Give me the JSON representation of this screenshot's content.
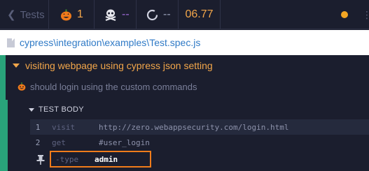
{
  "topbar": {
    "back_label": "Tests",
    "passed_count": "1",
    "failed_count": "--",
    "pending_count": "--",
    "duration": "06.77",
    "status_color": "#f4a623"
  },
  "spec": {
    "path": "cypress\\integration\\examples\\Test.spec.js"
  },
  "suite": {
    "title": "visiting webpage using cypress json setting",
    "test_title": "should login using the custom commands",
    "body_label": "TEST BODY",
    "commands": [
      {
        "num": "1",
        "name": "visit",
        "message": "http://zero.webappsecurity.com/login.html"
      },
      {
        "num": "2",
        "name": "get",
        "message": "#user_login"
      },
      {
        "num": "",
        "name": "-type",
        "message": "admin"
      }
    ]
  },
  "icons": {
    "passed": "pumpkin-icon",
    "failed": "skull-crossbones-icon",
    "pending": "circle-spinner-icon",
    "pin": "pin-icon"
  }
}
